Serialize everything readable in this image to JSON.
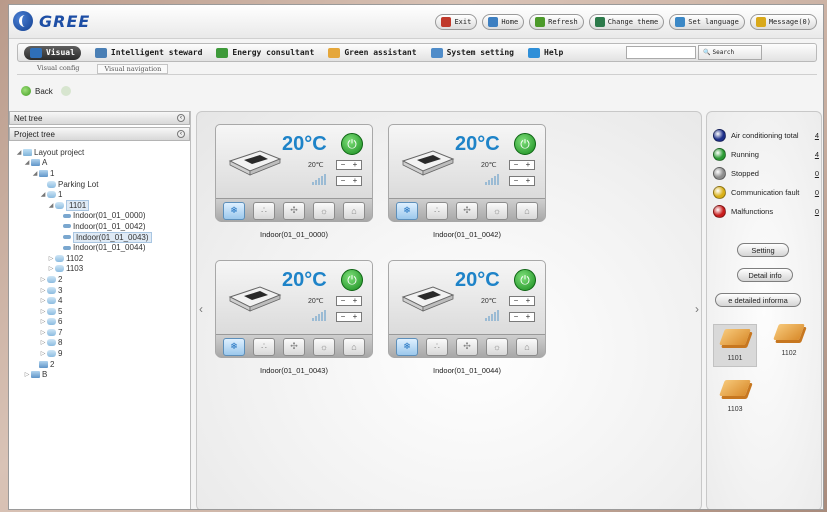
{
  "brand": {
    "name": "GREE"
  },
  "top_actions": [
    {
      "label": "Exit",
      "icon": "exit-icon",
      "color": "#c0392b"
    },
    {
      "label": "Home",
      "icon": "home-icon",
      "color": "#3d7fc1"
    },
    {
      "label": "Refresh",
      "icon": "refresh-icon",
      "color": "#4c9a2a"
    },
    {
      "label": "Change theme",
      "icon": "theme-icon",
      "color": "#2c7a4b"
    },
    {
      "label": "Set language",
      "icon": "language-icon",
      "color": "#3b88c6"
    },
    {
      "label": "Message(0)",
      "icon": "message-icon",
      "color": "#d9a91b"
    }
  ],
  "menu": [
    {
      "label": "Visual",
      "icon": "visual-icon",
      "active": true
    },
    {
      "label": "Intelligent steward",
      "icon": "steward-icon"
    },
    {
      "label": "Energy consultant",
      "icon": "energy-icon"
    },
    {
      "label": "Green assistant",
      "icon": "green-assistant-icon"
    },
    {
      "label": "System setting",
      "icon": "settings-icon"
    },
    {
      "label": "Help",
      "icon": "help-icon"
    }
  ],
  "search": {
    "placeholder": "",
    "button_label": "Search"
  },
  "subtabs": [
    {
      "label": "Visual config",
      "selected": false
    },
    {
      "label": "Visual navigation",
      "selected": true
    }
  ],
  "back_label": "Back",
  "left_panel": {
    "net_tree_label": "Net tree",
    "project_tree_label": "Project tree",
    "tree": [
      {
        "label": "Layout project",
        "level": 0,
        "type": "folder",
        "toggle": "◢"
      },
      {
        "label": "A",
        "level": 1,
        "type": "build",
        "toggle": "◢"
      },
      {
        "label": "1",
        "level": 2,
        "type": "build",
        "toggle": "◢"
      },
      {
        "label": "Parking Lot",
        "level": 3,
        "type": "floor",
        "toggle": ""
      },
      {
        "label": "1",
        "level": 3,
        "type": "floor",
        "toggle": "◢"
      },
      {
        "label": "1101",
        "level": 4,
        "type": "floor",
        "toggle": "◢",
        "highlight": true
      },
      {
        "label": "Indoor(01_01_0000)",
        "level": 5,
        "type": "indoor",
        "toggle": ""
      },
      {
        "label": "Indoor(01_01_0042)",
        "level": 5,
        "type": "indoor",
        "toggle": ""
      },
      {
        "label": "Indoor(01_01_0043)",
        "level": 5,
        "type": "indoor",
        "toggle": "",
        "highlight": true
      },
      {
        "label": "Indoor(01_01_0044)",
        "level": 5,
        "type": "indoor",
        "toggle": ""
      },
      {
        "label": "1102",
        "level": 4,
        "type": "floor",
        "toggle": "▷"
      },
      {
        "label": "1103",
        "level": 4,
        "type": "floor",
        "toggle": "▷"
      },
      {
        "label": "2",
        "level": 3,
        "type": "floor",
        "toggle": "▷"
      },
      {
        "label": "3",
        "level": 3,
        "type": "floor",
        "toggle": "▷"
      },
      {
        "label": "4",
        "level": 3,
        "type": "floor",
        "toggle": "▷"
      },
      {
        "label": "5",
        "level": 3,
        "type": "floor",
        "toggle": "▷"
      },
      {
        "label": "6",
        "level": 3,
        "type": "floor",
        "toggle": "▷"
      },
      {
        "label": "7",
        "level": 3,
        "type": "floor",
        "toggle": "▷"
      },
      {
        "label": "8",
        "level": 3,
        "type": "floor",
        "toggle": "▷"
      },
      {
        "label": "9",
        "level": 3,
        "type": "floor",
        "toggle": "▷"
      },
      {
        "label": "2",
        "level": 2,
        "type": "build",
        "toggle": ""
      },
      {
        "label": "B",
        "level": 1,
        "type": "build",
        "toggle": "▷"
      }
    ]
  },
  "units": [
    {
      "name": "Indoor(01_01_0000)",
      "temp": "20°C",
      "set_temp": "20℃",
      "mode_on": "cool-icon"
    },
    {
      "name": "Indoor(01_01_0042)",
      "temp": "20°C",
      "set_temp": "20℃",
      "mode_on": "cool-icon"
    },
    {
      "name": "Indoor(01_01_0043)",
      "temp": "20°C",
      "set_temp": "20℃",
      "mode_on": "cool-icon"
    },
    {
      "name": "Indoor(01_01_0044)",
      "temp": "20°C",
      "set_temp": "20℃",
      "mode_on": "cool-icon"
    }
  ],
  "unit_controls": {
    "minus": "−",
    "plus": "+",
    "power_glyph": "⏻"
  },
  "mode_buttons": [
    {
      "icon": "cool-icon",
      "glyph": "❄"
    },
    {
      "icon": "dry-icon",
      "glyph": "∴"
    },
    {
      "icon": "fan-icon",
      "glyph": "✣"
    },
    {
      "icon": "heat-icon",
      "glyph": "☼"
    },
    {
      "icon": "auto-icon",
      "glyph": "⌂"
    }
  ],
  "status_legend": [
    {
      "label": "Air conditioning total",
      "count": "4",
      "color": "#1d2f8a"
    },
    {
      "label": "Running",
      "count": "4",
      "color": "#2a9a33"
    },
    {
      "label": "Stopped",
      "count": "0",
      "color": "#8c8c8c"
    },
    {
      "label": "Communication fault",
      "count": "0",
      "color": "#d9b018"
    },
    {
      "label": "Malfunctions",
      "count": "0",
      "color": "#c81d1d"
    }
  ],
  "right_buttons": {
    "setting": "Setting",
    "detail_info": "Detail info",
    "more_detailed": "e detailed informa"
  },
  "buildings": [
    {
      "label": "1101",
      "selected": true
    },
    {
      "label": "1102",
      "selected": false
    },
    {
      "label": "1103",
      "selected": false
    }
  ]
}
